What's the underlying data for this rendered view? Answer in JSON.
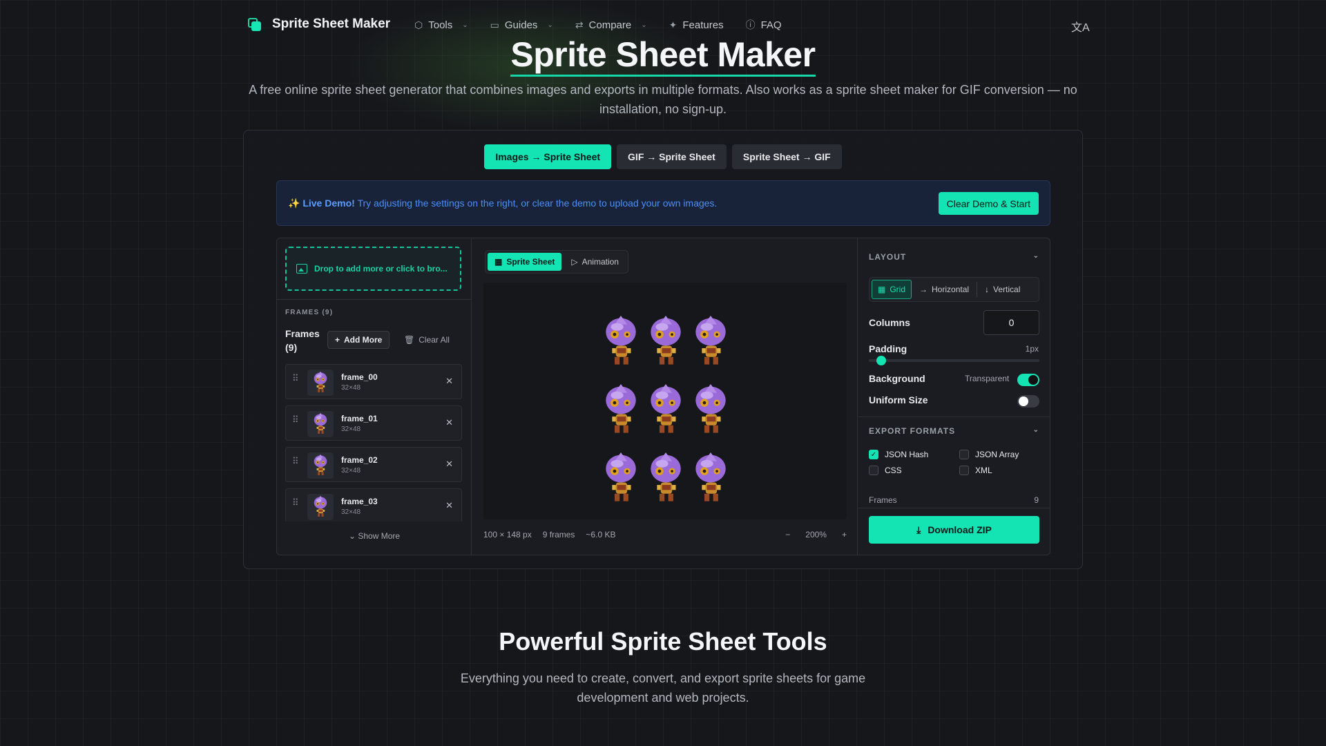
{
  "brand": {
    "name": "Sprite Sheet Maker"
  },
  "nav": {
    "items": [
      {
        "label": "Tools",
        "icon": "cube-icon",
        "dropdown": true
      },
      {
        "label": "Guides",
        "icon": "book-icon",
        "dropdown": true
      },
      {
        "label": "Compare",
        "icon": "compare-icon",
        "dropdown": true
      },
      {
        "label": "Features",
        "icon": "sparkles-icon",
        "dropdown": false
      },
      {
        "label": "FAQ",
        "icon": "help-circle-icon",
        "dropdown": false
      }
    ]
  },
  "hero": {
    "title": "Sprite Sheet Maker",
    "subtitle": "A free online sprite sheet generator that combines images and exports in multiple formats. Also works as a sprite sheet maker for GIF conversion — no installation, no sign-up."
  },
  "mode_tabs": [
    {
      "label": "Images → Sprite Sheet",
      "active": true
    },
    {
      "label": "GIF → Sprite Sheet",
      "active": false
    },
    {
      "label": "Sprite Sheet → GIF",
      "active": false
    }
  ],
  "demo": {
    "emoji": "✨",
    "highlight": "Live Demo!",
    "text": "Try adjusting the settings on the right, or clear the demo to upload your own images.",
    "button": "Clear Demo & Start"
  },
  "left_panel": {
    "dropzone": "Drop to add more or click to bro...",
    "caption": "FRAMES (9)",
    "title": "Frames (9)",
    "add_more": "Add More",
    "clear_all": "Clear All",
    "frames": [
      {
        "name": "frame_00",
        "size": "32×48"
      },
      {
        "name": "frame_01",
        "size": "32×48"
      },
      {
        "name": "frame_02",
        "size": "32×48"
      },
      {
        "name": "frame_03",
        "size": "32×48"
      }
    ],
    "show_more": "Show More"
  },
  "center": {
    "tabs": [
      {
        "label": "Sprite Sheet",
        "active": true
      },
      {
        "label": "Animation",
        "active": false
      }
    ],
    "status": {
      "dimensions": "100 × 148 px",
      "frames": "9 frames",
      "size": "~6.0 KB",
      "zoom": "200%"
    }
  },
  "right_panel": {
    "layout_title": "LAYOUT",
    "layout_options": [
      {
        "label": "Grid",
        "active": true
      },
      {
        "label": "Horizontal",
        "active": false
      },
      {
        "label": "Vertical",
        "active": false
      }
    ],
    "columns_label": "Columns",
    "columns_value": "0",
    "padding_label": "Padding",
    "padding_value": "1px",
    "padding_level": 0.03,
    "background_label": "Background",
    "background_value": "Transparent",
    "background_on": true,
    "uniform_label": "Uniform Size",
    "uniform_on": false,
    "export_title": "EXPORT FORMATS",
    "formats": [
      {
        "label": "JSON Hash",
        "checked": true
      },
      {
        "label": "JSON Array",
        "checked": false
      },
      {
        "label": "CSS",
        "checked": false
      },
      {
        "label": "XML",
        "checked": false
      }
    ],
    "frames_label": "Frames",
    "frames_value": "9",
    "download": "Download ZIP"
  },
  "section2": {
    "title": "Powerful Sprite Sheet Tools",
    "subtitle": "Everything you need to create, convert, and export sprite sheets for game development and web projects."
  },
  "colors": {
    "accent": "#14e3b4",
    "demo_text": "#4c8ef5",
    "background": "#16171b"
  }
}
